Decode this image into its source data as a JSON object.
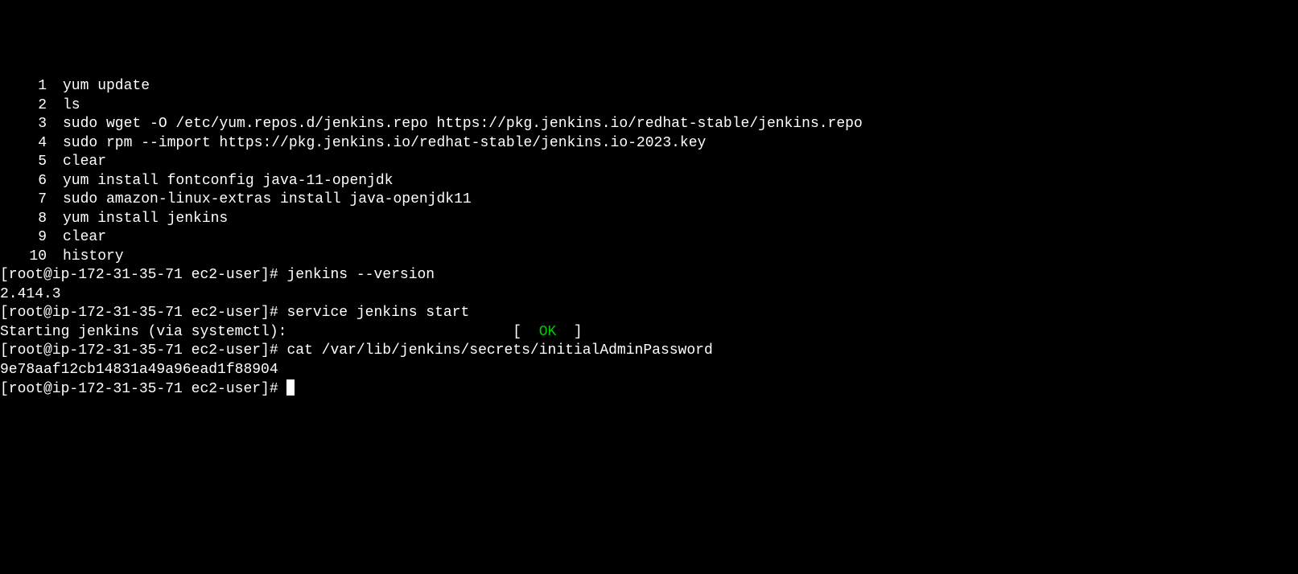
{
  "history": [
    {
      "n": "1",
      "cmd": "yum update"
    },
    {
      "n": "2",
      "cmd": "ls"
    },
    {
      "n": "3",
      "cmd": "sudo wget -O /etc/yum.repos.d/jenkins.repo https://pkg.jenkins.io/redhat-stable/jenkins.repo"
    },
    {
      "n": "4",
      "cmd": "sudo rpm --import https://pkg.jenkins.io/redhat-stable/jenkins.io-2023.key"
    },
    {
      "n": "5",
      "cmd": "clear"
    },
    {
      "n": "6",
      "cmd": "yum install fontconfig java-11-openjdk"
    },
    {
      "n": "7",
      "cmd": "sudo amazon-linux-extras install java-openjdk11"
    },
    {
      "n": "8",
      "cmd": "yum install jenkins"
    },
    {
      "n": "9",
      "cmd": "clear"
    },
    {
      "n": "10",
      "cmd": "history"
    }
  ],
  "prompt": "[root@ip-172-31-35-71 ec2-user]# ",
  "cmd_version": "jenkins --version",
  "out_version": "2.414.3",
  "cmd_service": "service jenkins start",
  "out_service_pre": "Starting jenkins (via systemctl):                          [  ",
  "out_service_ok": "OK",
  "out_service_post": "  ]",
  "cmd_cat": "cat /var/lib/jenkins/secrets/initialAdminPassword",
  "out_password": "9e78aaf12cb14831a49a96ead1f88904"
}
